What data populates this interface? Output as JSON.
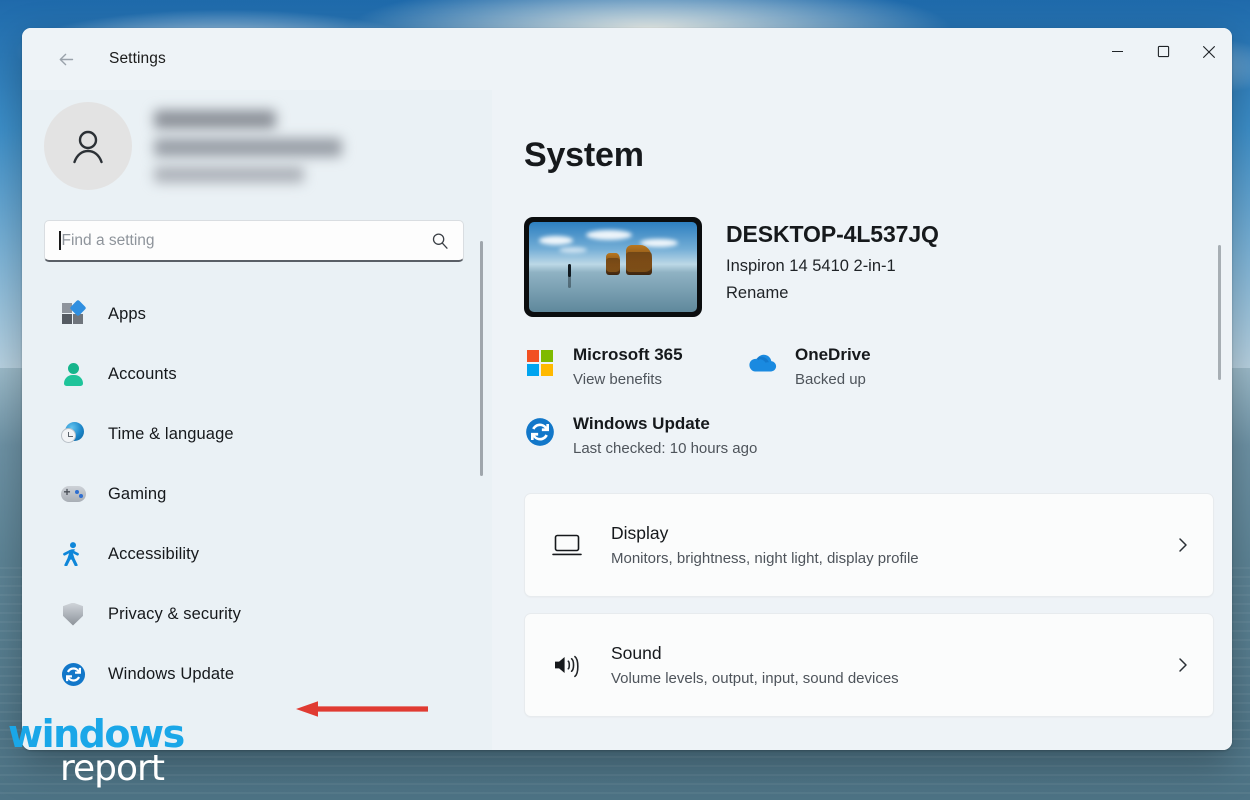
{
  "window": {
    "title": "Settings",
    "back_icon": "back-arrow-icon",
    "controls": {
      "minimize": "minimize-icon",
      "maximize": "maximize-icon",
      "close": "close-icon"
    }
  },
  "sidebar": {
    "account": {
      "avatar_icon": "person-avatar-icon",
      "name_redacted": "",
      "email_redacted": ""
    },
    "search": {
      "value": "",
      "placeholder": "Find a setting",
      "icon": "search-icon"
    },
    "items": [
      {
        "label": "Apps",
        "icon": "apps-icon"
      },
      {
        "label": "Accounts",
        "icon": "accounts-person-icon"
      },
      {
        "label": "Time & language",
        "icon": "time-language-globe-icon"
      },
      {
        "label": "Gaming",
        "icon": "gaming-controller-icon"
      },
      {
        "label": "Accessibility",
        "icon": "accessibility-person-icon"
      },
      {
        "label": "Privacy & security",
        "icon": "shield-icon"
      },
      {
        "label": "Windows Update",
        "icon": "windows-update-refresh-icon"
      }
    ]
  },
  "main": {
    "page_title": "System",
    "device": {
      "name": "DESKTOP-4L537JQ",
      "model": "Inspiron 14 5410 2-in-1",
      "rename_label": "Rename",
      "thumbnail": "desktop-wallpaper-thumbnail"
    },
    "status": [
      {
        "title": "Microsoft 365",
        "subtitle": "View benefits",
        "icon": "microsoft-365-icon"
      },
      {
        "title": "OneDrive",
        "subtitle": "Backed up",
        "icon": "onedrive-cloud-icon"
      },
      {
        "title": "Windows Update",
        "subtitle": "Last checked: 10 hours ago",
        "icon": "windows-update-refresh-icon"
      }
    ],
    "cards": [
      {
        "title": "Display",
        "subtitle": "Monitors, brightness, night light, display profile",
        "icon": "display-monitor-icon",
        "chevron": "chevron-right-icon"
      },
      {
        "title": "Sound",
        "subtitle": "Volume levels, output, input, sound devices",
        "icon": "sound-speaker-icon",
        "chevron": "chevron-right-icon"
      }
    ]
  },
  "annotation": {
    "arrow": "red-left-arrow-annotation",
    "color": "#e03b32",
    "points_to": "Windows Update"
  },
  "watermark": {
    "line1": "windows",
    "line2": "report",
    "color1": "#1aa7e8",
    "color2": "#ffffff"
  },
  "colors": {
    "window_bg": "#eef3f7",
    "sidebar_bg": "#eaf1f5",
    "card_bg": "#fbfcfc",
    "text_primary": "#16191c",
    "text_secondary": "#4e545b",
    "accent_blue": "#1277c9"
  }
}
